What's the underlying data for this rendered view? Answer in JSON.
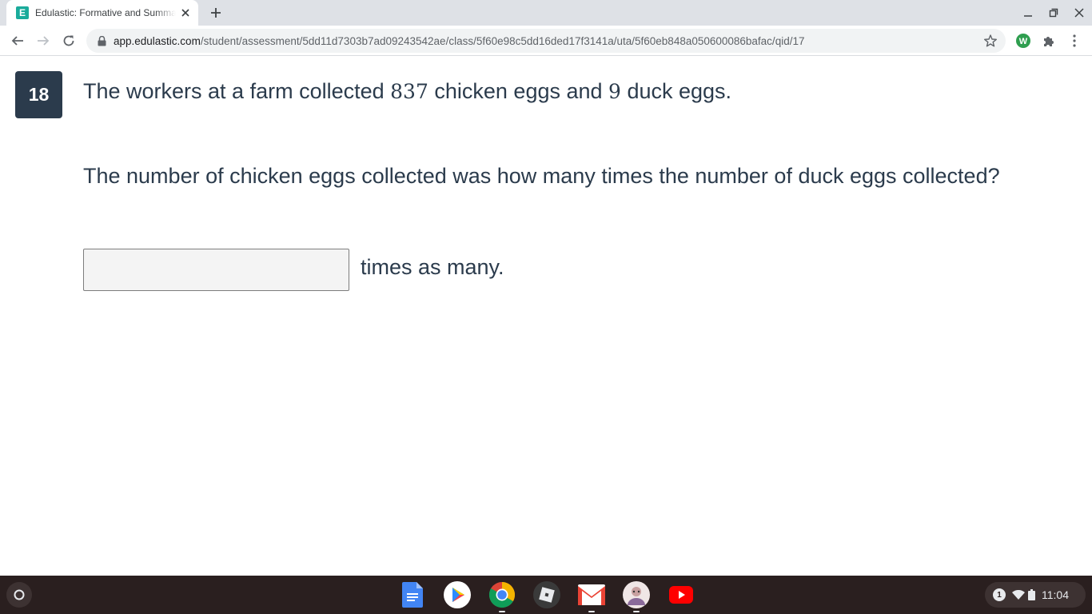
{
  "browser": {
    "tab_title": "Edulastic: Formative and Summative Assessments Made Easy",
    "favicon_letter": "E",
    "url_host": "app.edulastic.com",
    "url_path": "/student/assessment/5dd11d7303b7ad09243542ae/class/5f60e98c5dd16ded17f3141a/uta/5f60eb848a050600086bafac/qid/17",
    "extension_letter": "W",
    "icons": [
      "new-tab-icon",
      "minimize-icon",
      "restore-icon",
      "close-icon",
      "back-icon",
      "forward-icon",
      "reload-icon",
      "lock-icon",
      "star-icon",
      "puzzle-icon",
      "more-icon"
    ]
  },
  "question": {
    "number": "18",
    "stem_part1": "The workers at a farm collected ",
    "chicken_eggs": "837",
    "stem_part2": " chicken eggs and ",
    "duck_eggs": "9",
    "stem_part3": " duck eggs.",
    "prompt": "The number of chicken eggs collected was how many times the number of duck eggs collected?",
    "answer_value": "",
    "answer_suffix": "times as many."
  },
  "shelf": {
    "apps": [
      "google-docs-icon",
      "play-store-icon",
      "chrome-icon",
      "roblox-icon",
      "gmail-icon",
      "avatar-app-icon",
      "youtube-icon"
    ],
    "notification_count": "1",
    "time": "11:04"
  },
  "colors": {
    "text": "#2b3b4c",
    "badge_bg": "#2b3b4c",
    "favicon": "#1aab9b",
    "shelf_bg": "#2a1f1f"
  }
}
